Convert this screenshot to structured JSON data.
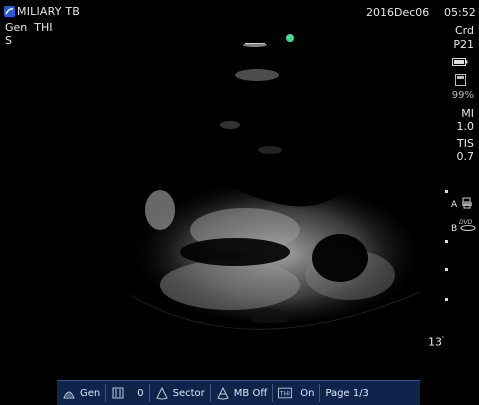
{
  "header": {
    "title": "MILIARY TB",
    "preset": "Gen  THI",
    "sub_mode": "S",
    "date": "2016Dec06",
    "time": "05:52"
  },
  "side_panel": {
    "exam": "Crd",
    "probe": "P21",
    "battery_pct": "99%",
    "mi_label": "MI",
    "mi_value": "1.0",
    "tis_label": "TIS",
    "tis_value": "0.7",
    "marker_a": "A",
    "marker_b": "B"
  },
  "depth": "13",
  "status_bar": {
    "gen_label": "Gen",
    "gain_value": "0",
    "sector_label": "Sector",
    "mb_label": "MB Off",
    "thi_label": "THI",
    "thi_value": "On",
    "page_label": "Page 1/3"
  },
  "colors": {
    "background": "#000000",
    "orientation_dot": "#3fe08a",
    "status_bar_bg": "#10234a"
  },
  "icons": [
    "brand-icon",
    "battery-icon",
    "printer-icon",
    "dvd-icon",
    "gen-icon",
    "gain-icon",
    "sector-icon",
    "mb-icon",
    "thi-icon"
  ]
}
